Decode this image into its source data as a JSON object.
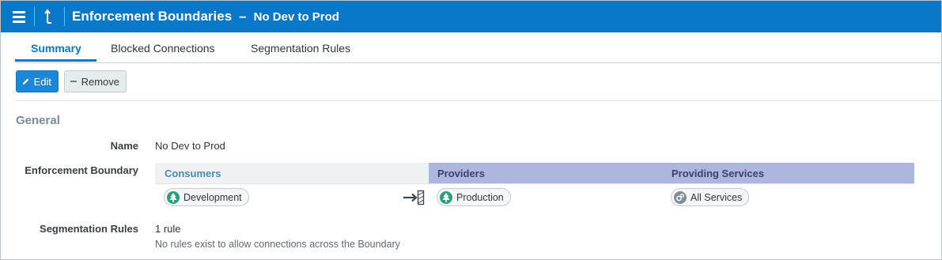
{
  "header": {
    "title": "Enforcement Boundaries",
    "separator": "–",
    "subtitle": "No Dev to Prod",
    "bg_color": "#0a78c8"
  },
  "tabs": [
    {
      "label": "Summary",
      "active": true
    },
    {
      "label": "Blocked Connections",
      "active": false
    },
    {
      "label": "Segmentation Rules",
      "active": false
    }
  ],
  "toolbar": {
    "edit_label": "Edit",
    "remove_label": "Remove"
  },
  "general": {
    "section_title": "General",
    "name_label": "Name",
    "name_value": "No Dev to Prod",
    "boundary_label": "Enforcement Boundary",
    "boundary": {
      "consumers_header": "Consumers",
      "providers_header": "Providers",
      "services_header": "Providing Services",
      "consumer": {
        "label": "Development",
        "icon": "tree-icon"
      },
      "provider": {
        "label": "Production",
        "icon": "tree-icon"
      },
      "service": {
        "label": "All Services",
        "icon": "gears-icon"
      }
    },
    "rules_label": "Segmentation Rules",
    "rules_count": "1 rule",
    "rules_note": "No rules exist to allow connections across the Boundary"
  }
}
